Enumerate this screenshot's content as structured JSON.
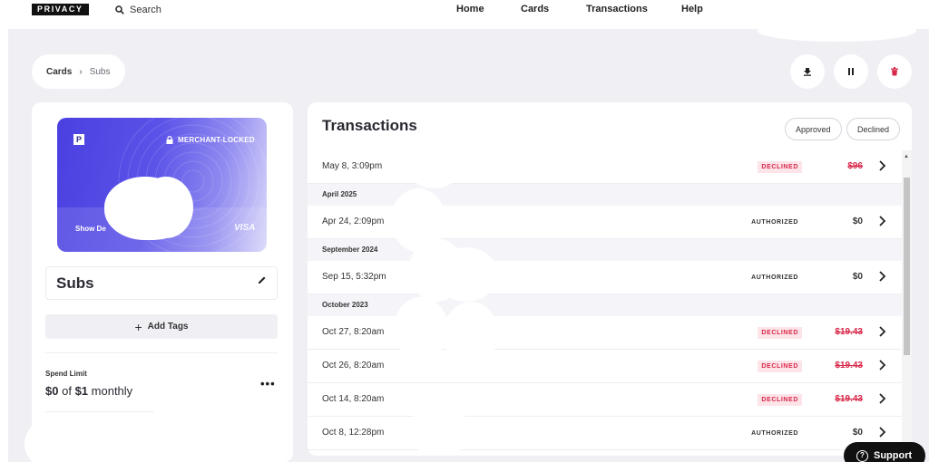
{
  "header": {
    "logo": "PRIVACY",
    "search_label": "Search",
    "nav": [
      "Home",
      "Cards",
      "Transactions",
      "Help"
    ]
  },
  "breadcrumb": {
    "root": "Cards",
    "current": "Subs"
  },
  "actions": {
    "download_icon": "download-icon",
    "pause_icon": "pause-icon",
    "delete_icon": "trash-icon"
  },
  "card": {
    "logo_letter": "P",
    "lock_label": "MERCHANT-LOCKED",
    "show_details": "Show De",
    "network": "VISA",
    "name": "Subs",
    "add_tags": "Add Tags",
    "spend_limit_label": "Spend Limit",
    "spend_used": "$0",
    "spend_of": "of",
    "spend_limit": "$1",
    "spend_period": "monthly",
    "more": "•••"
  },
  "transactions": {
    "title": "Transactions",
    "filters": [
      "Approved",
      "Declined"
    ],
    "rows": [
      {
        "type": "tx",
        "date": "May 8, 3:09pm",
        "status": "DECLINED",
        "amount": "$96",
        "kind": "declined"
      },
      {
        "type": "group",
        "label": "April 2025"
      },
      {
        "type": "tx",
        "date": "Apr 24, 2:09pm",
        "status": "AUTHORIZED",
        "amount": "$0",
        "kind": "authorized"
      },
      {
        "type": "group",
        "label": "September 2024"
      },
      {
        "type": "tx",
        "date": "Sep 15, 5:32pm",
        "status": "AUTHORIZED",
        "amount": "$0",
        "kind": "authorized"
      },
      {
        "type": "group",
        "label": "October 2023"
      },
      {
        "type": "tx",
        "date": "Oct 27, 8:20am",
        "status": "DECLINED",
        "amount": "$19.43",
        "kind": "declined"
      },
      {
        "type": "tx",
        "date": "Oct 26, 8:20am",
        "status": "DECLINED",
        "amount": "$19.43",
        "kind": "declined"
      },
      {
        "type": "tx",
        "date": "Oct 14, 8:20am",
        "status": "DECLINED",
        "amount": "$19.43",
        "kind": "declined"
      },
      {
        "type": "tx",
        "date": "Oct 8, 12:28pm",
        "status": "AUTHORIZED",
        "amount": "$0",
        "kind": "authorized"
      }
    ]
  },
  "support": {
    "label": "Support",
    "icon": "?"
  },
  "colors": {
    "accent": "#4a40e0",
    "declined": "#d8284a",
    "background": "#f0eff4"
  }
}
